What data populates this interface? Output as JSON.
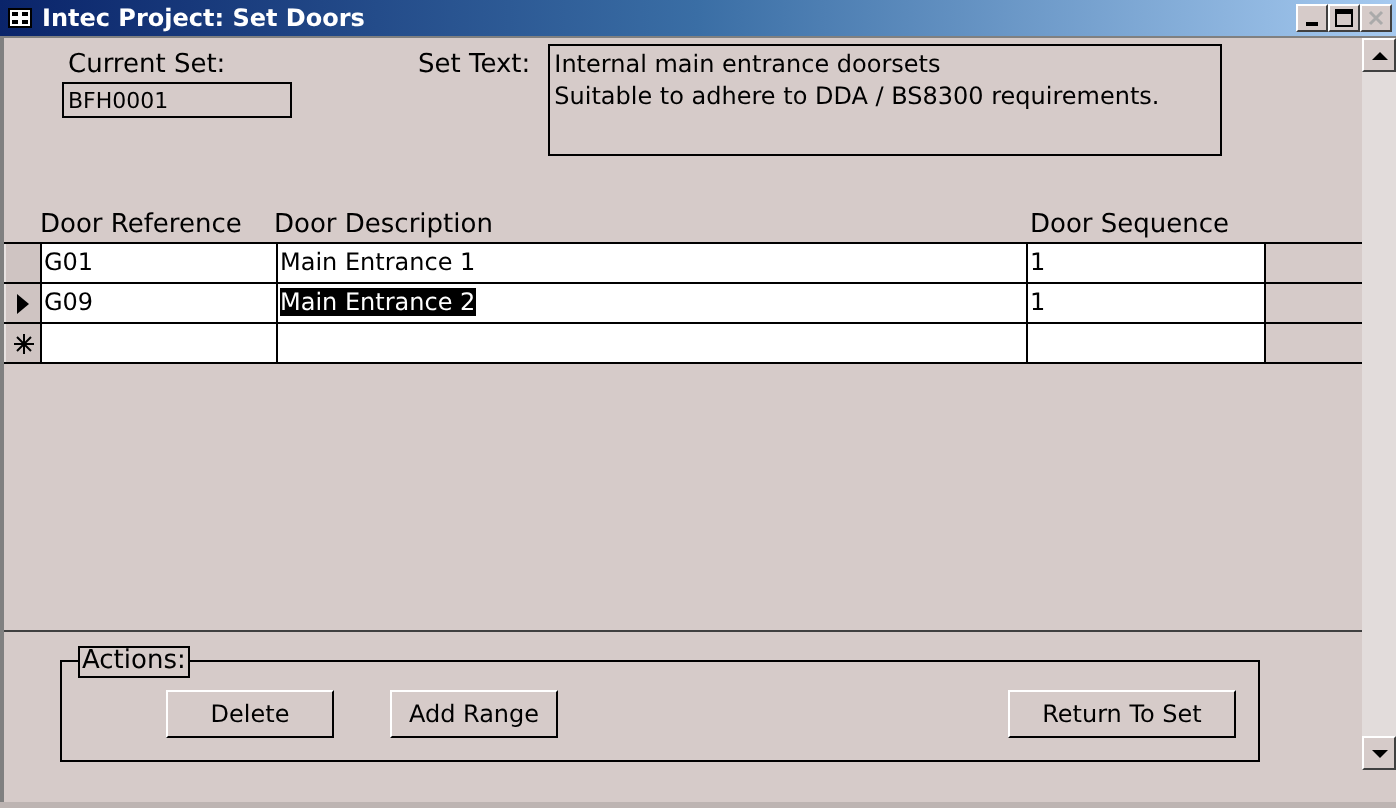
{
  "window": {
    "title": "Intec Project: Set Doors"
  },
  "current_set": {
    "label": "Current Set:",
    "value": "BFH0001"
  },
  "set_text": {
    "label": "Set Text:",
    "lines": [
      "Internal main entrance doorsets",
      "Suitable to adhere to DDA / BS8300 requirements."
    ]
  },
  "table": {
    "columns": [
      "Door Reference",
      "Door Description",
      "Door Sequence"
    ],
    "rows": [
      {
        "kind": "record",
        "selected": false,
        "cells": [
          "G01",
          "Main Entrance 1",
          "1"
        ]
      },
      {
        "kind": "record",
        "selected": true,
        "cells": [
          "G09",
          "Main Entrance 2",
          "1"
        ]
      },
      {
        "kind": "new",
        "cells": []
      }
    ]
  },
  "actions": {
    "label": "Actions:",
    "buttons": [
      "Delete",
      "Add Range",
      "Return To Set"
    ]
  }
}
